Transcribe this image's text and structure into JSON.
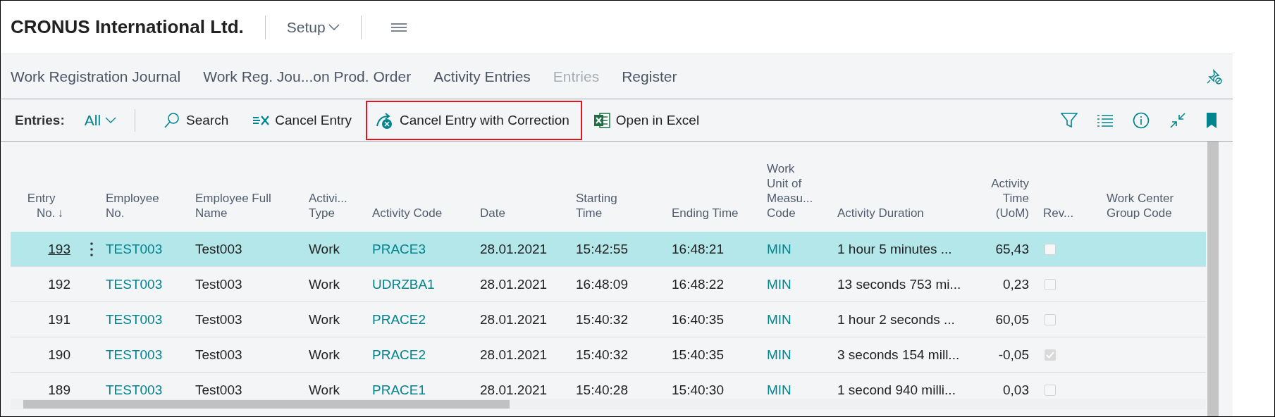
{
  "app": {
    "company": "CRONUS International Ltd.",
    "role_menu": "Setup"
  },
  "nav_tabs": [
    {
      "label": "Work Registration Journal",
      "selected": false
    },
    {
      "label": "Work Reg. Jou...on Prod. Order",
      "selected": false
    },
    {
      "label": "Activity Entries",
      "selected": false
    },
    {
      "label": "Entries",
      "selected": true
    },
    {
      "label": "Register",
      "selected": false
    }
  ],
  "action_bar": {
    "filter_label": "Entries:",
    "filter_value": "All",
    "actions": [
      {
        "label": "Search",
        "kind": "search",
        "highlighted": false
      },
      {
        "label": "Cancel Entry",
        "kind": "cancel",
        "highlighted": false
      },
      {
        "label": "Cancel Entry with Correction",
        "kind": "correct",
        "highlighted": true
      },
      {
        "label": "Open in Excel",
        "kind": "excel",
        "highlighted": false
      }
    ]
  },
  "table": {
    "columns": [
      {
        "label": "Entry\nNo.",
        "kind": "number",
        "sort_icon": "↓"
      },
      {
        "label": "Employee\nNo.",
        "kind": "link"
      },
      {
        "label": "Employee Full\nName",
        "kind": "text"
      },
      {
        "label": "Activi...\nType",
        "kind": "text"
      },
      {
        "label": "Activity Code",
        "kind": "link"
      },
      {
        "label": "Date",
        "kind": "text"
      },
      {
        "label": "Starting\nTime",
        "kind": "text"
      },
      {
        "label": "Ending Time",
        "kind": "text"
      },
      {
        "label": "Work\nUnit of\nMeasu...\nCode",
        "kind": "link"
      },
      {
        "label": "Activity Duration",
        "kind": "text"
      },
      {
        "label": "Activity\nTime\n(UoM)",
        "kind": "number"
      },
      {
        "label": "Rev...",
        "kind": "check"
      },
      {
        "label": "Work Center\nGroup Code",
        "kind": "text"
      }
    ],
    "rows": [
      {
        "selected": true,
        "reversed": false,
        "cells": [
          "193",
          "TEST003",
          "Test003",
          "Work",
          "PRACE3",
          "28.01.2021",
          "15:42:55",
          "16:48:21",
          "MIN",
          "1 hour 5 minutes ...",
          "65,43"
        ]
      },
      {
        "selected": false,
        "reversed": false,
        "cells": [
          "192",
          "TEST003",
          "Test003",
          "Work",
          "UDRZBA1",
          "28.01.2021",
          "16:48:09",
          "16:48:22",
          "MIN",
          "13 seconds 753 mi...",
          "0,23"
        ]
      },
      {
        "selected": false,
        "reversed": false,
        "cells": [
          "191",
          "TEST003",
          "Test003",
          "Work",
          "PRACE2",
          "28.01.2021",
          "15:40:32",
          "16:40:35",
          "MIN",
          "1 hour 2 seconds ...",
          "60,05"
        ]
      },
      {
        "selected": false,
        "reversed": true,
        "cells": [
          "190",
          "TEST003",
          "Test003",
          "Work",
          "PRACE2",
          "28.01.2021",
          "15:40:32",
          "15:40:35",
          "MIN",
          "3 seconds 154 mill...",
          "-0,05"
        ]
      },
      {
        "selected": false,
        "reversed": false,
        "cells": [
          "189",
          "TEST003",
          "Test003",
          "Work",
          "PRACE1",
          "28.01.2021",
          "15:40:28",
          "15:40:30",
          "MIN",
          "1 second 940 milli...",
          "0,03"
        ]
      }
    ]
  }
}
